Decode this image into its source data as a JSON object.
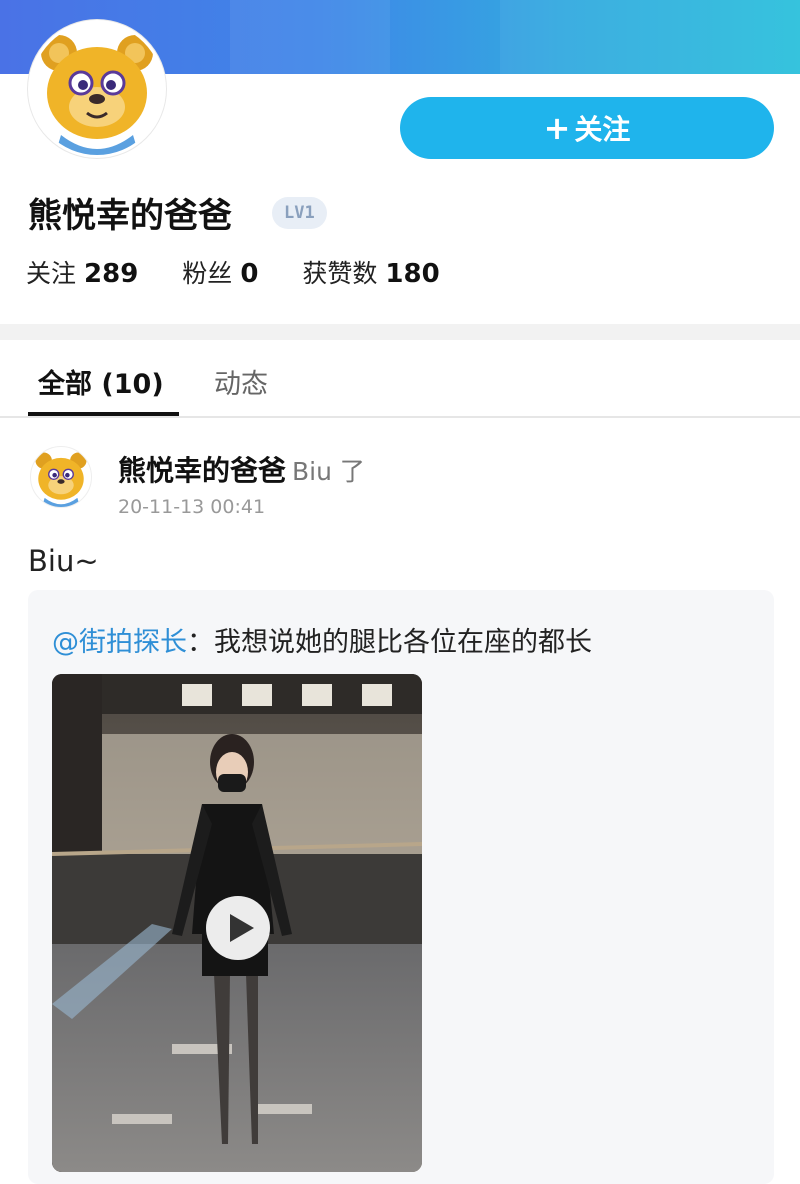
{
  "profile": {
    "username": "熊悦幸的爸爸",
    "level": "LV1",
    "follow_button": "关注",
    "stats": [
      {
        "label": "关注",
        "value": "289"
      },
      {
        "label": "粉丝",
        "value": "0"
      },
      {
        "label": "获赞数",
        "value": "180"
      }
    ]
  },
  "tabs": [
    {
      "label": "全部 (10)",
      "active": true
    },
    {
      "label": "动态",
      "active": false
    }
  ],
  "post": {
    "author": "熊悦幸的爸爸",
    "action": "Biu 了",
    "time": "20-11-13 00:41",
    "text": "Biu~",
    "quote": {
      "mention": "@街拍探长",
      "separator": "：",
      "text": "我想说她的腿比各位在座的都长"
    }
  },
  "icons": {
    "avatar": "bear-avatar-icon",
    "play": "play-icon",
    "plus": "plus-icon"
  },
  "colors": {
    "accent": "#1fb4ec",
    "mention": "#2f8fd6"
  }
}
